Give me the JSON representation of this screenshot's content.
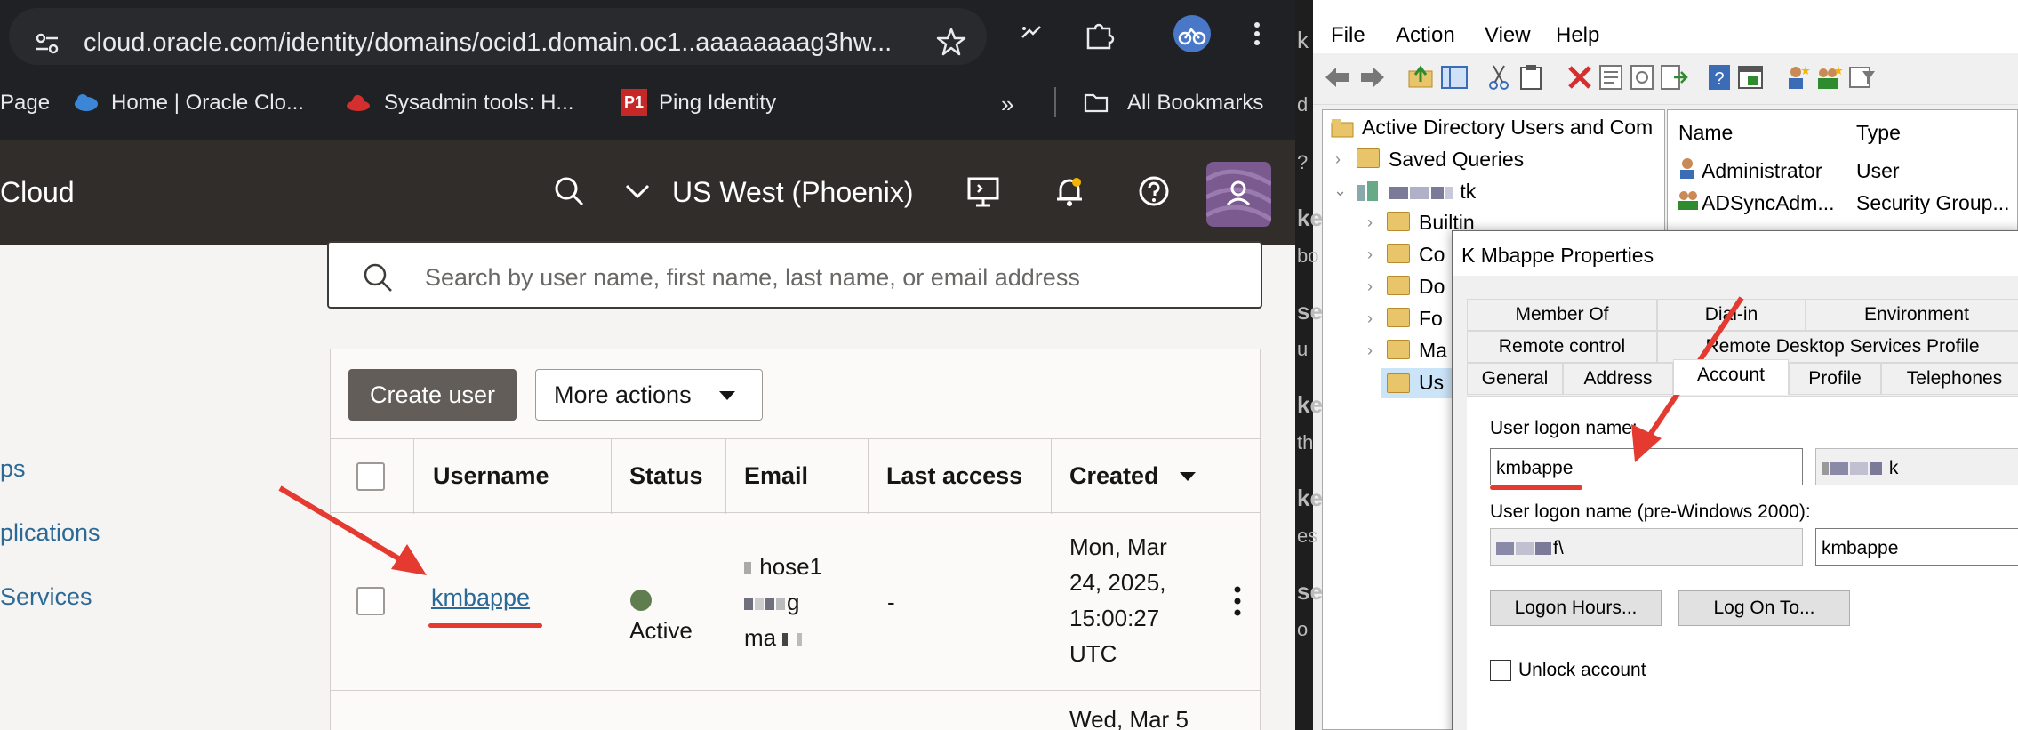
{
  "browser": {
    "url": "cloud.oracle.com/identity/domains/ocid1.domain.oc1..aaaaaaaag3hw...",
    "bookmarks": [
      {
        "label": "Page"
      },
      {
        "label": "Home | Oracle Clo..."
      },
      {
        "label": "Sysadmin tools: H..."
      },
      {
        "label": "Ping Identity"
      },
      {
        "label": "All Bookmarks"
      }
    ],
    "overflow": "»"
  },
  "oci": {
    "brand": "Cloud",
    "region": "US West (Phoenix)",
    "nav": [
      "ps",
      "plications",
      "Services"
    ],
    "search_placeholder": "Search by user name, first name, last name, or email address",
    "create_user": "Create user",
    "more_actions": "More actions",
    "columns": [
      "Username",
      "Status",
      "Email",
      "Last access",
      "Created"
    ],
    "row": {
      "username": "kmbappe",
      "status": "Active",
      "email_lines": [
        "hose1",
        "g",
        "ma"
      ],
      "last_access": "-",
      "created_lines": [
        "Mon, Mar",
        "24, 2025,",
        "15:00:27",
        "UTC"
      ]
    },
    "next_row_created": "Wed, Mar 5"
  },
  "windows": {
    "menu": [
      "File",
      "Action",
      "View",
      "Help"
    ],
    "tree": {
      "root": "Active Directory Users and Com",
      "saved_queries": "Saved Queries",
      "domain": "tk",
      "children": [
        "Builtin",
        "Co",
        "Do",
        "Fo",
        "Ma",
        "Us"
      ]
    },
    "list": {
      "col_name": "Name",
      "col_type": "Type",
      "rows": [
        {
          "name": "Administrator",
          "type": "User"
        },
        {
          "name": "ADSyncAdm...",
          "type": "Security Group..."
        }
      ]
    },
    "dialog": {
      "title": "K Mbappe Properties",
      "tabs_row1": [
        "Member Of",
        "Dial-in",
        "Environment"
      ],
      "tabs_row2": [
        "Remote control",
        "Remote Desktop Services Profile"
      ],
      "tabs_row3": [
        "General",
        "Address",
        "Account",
        "Profile",
        "Telephones"
      ],
      "logon_label": "User logon name:",
      "logon_value": "kmbappe",
      "logon_domain": "k",
      "pre2000_label": "User logon name (pre-Windows 2000):",
      "pre2000_domain": "f\\",
      "pre2000_value": "kmbappe",
      "logon_hours": "Logon Hours...",
      "log_on_to": "Log On To...",
      "unlock": "Unlock account"
    },
    "strip_chars": [
      "k",
      "d",
      "?",
      "ke",
      "bo",
      "se",
      "u",
      "ke",
      "th",
      "ke",
      "es",
      "se",
      "o"
    ]
  },
  "colors": {
    "oci_header": "#312d2a",
    "oci_link": "#2b6a96",
    "annotation_red": "#e53a2f",
    "status_green": "#5f7d4f"
  }
}
